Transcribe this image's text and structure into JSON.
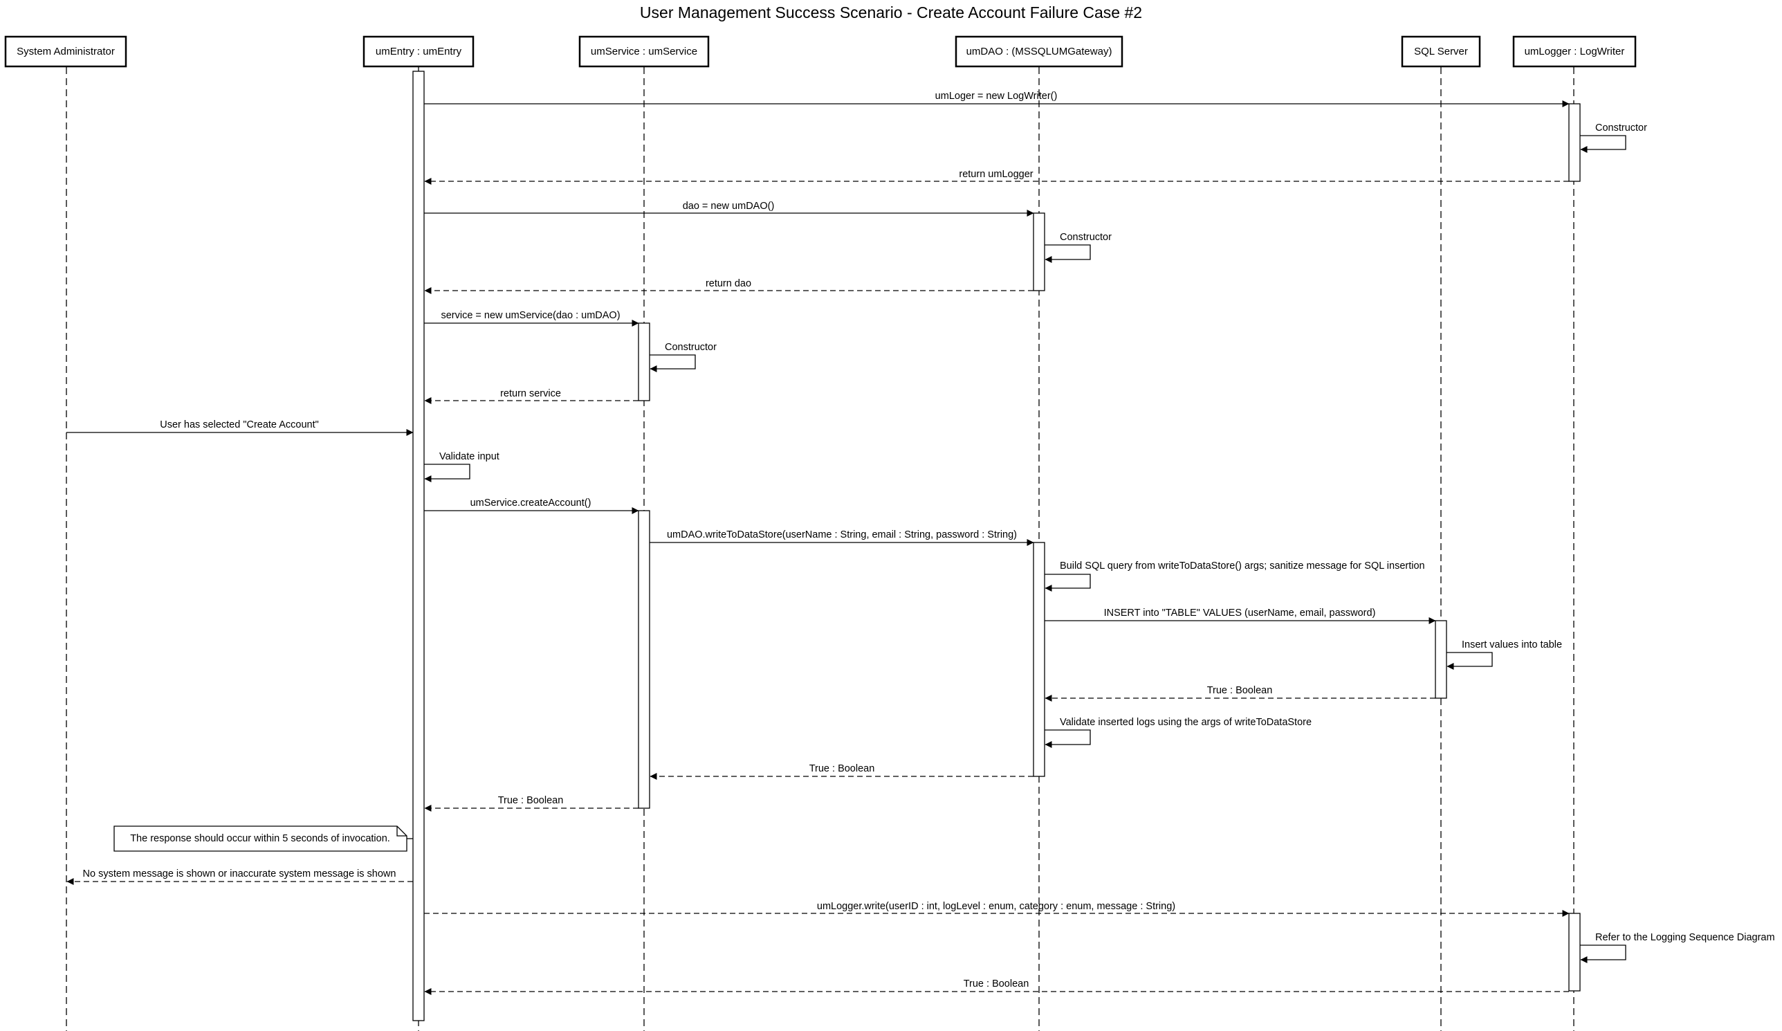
{
  "title": "User Management Success Scenario - Create Account Failure Case #2",
  "participants": [
    {
      "id": "admin",
      "label": "System Administrator"
    },
    {
      "id": "entry",
      "label": "umEntry : umEntry"
    },
    {
      "id": "service",
      "label": "umService : umService"
    },
    {
      "id": "dao",
      "label": "umDAO : (MSSQLUMGateway)"
    },
    {
      "id": "sql",
      "label": "SQL Server"
    },
    {
      "id": "logger",
      "label": "umLogger : LogWriter"
    }
  ],
  "messages": [
    {
      "from": "entry",
      "to": "logger",
      "kind": "sync",
      "label": "umLoger = new LogWriter()"
    },
    {
      "from": "logger",
      "to": "logger",
      "kind": "self",
      "label": "Constructor"
    },
    {
      "from": "logger",
      "to": "entry",
      "kind": "return",
      "label": "return umLogger"
    },
    {
      "from": "entry",
      "to": "dao",
      "kind": "sync",
      "label": "dao = new umDAO()"
    },
    {
      "from": "dao",
      "to": "dao",
      "kind": "self",
      "label": "Constructor"
    },
    {
      "from": "dao",
      "to": "entry",
      "kind": "return",
      "label": "return dao"
    },
    {
      "from": "entry",
      "to": "service",
      "kind": "sync",
      "label": "service = new umService(dao : umDAO)"
    },
    {
      "from": "service",
      "to": "service",
      "kind": "self",
      "label": "Constructor"
    },
    {
      "from": "service",
      "to": "entry",
      "kind": "return",
      "label": "return service"
    },
    {
      "from": "admin",
      "to": "entry",
      "kind": "sync",
      "label": "User has selected \"Create Account\""
    },
    {
      "from": "entry",
      "to": "entry",
      "kind": "self",
      "label": "Validate input"
    },
    {
      "from": "entry",
      "to": "service",
      "kind": "sync",
      "label": "umService.createAccount()"
    },
    {
      "from": "service",
      "to": "dao",
      "kind": "sync",
      "label": "umDAO.writeToDataStore(userName : String, email : String, password : String)"
    },
    {
      "from": "dao",
      "to": "dao",
      "kind": "self",
      "label": "Build SQL query from writeToDataStore() args; sanitize message for SQL insertion"
    },
    {
      "from": "dao",
      "to": "sql",
      "kind": "sync",
      "label": "INSERT into \"TABLE\" VALUES (userName, email, password)"
    },
    {
      "from": "sql",
      "to": "sql",
      "kind": "self",
      "label": "Insert values into table"
    },
    {
      "from": "sql",
      "to": "dao",
      "kind": "return",
      "label": "True : Boolean"
    },
    {
      "from": "dao",
      "to": "dao",
      "kind": "self",
      "label": "Validate inserted logs using the args of writeToDataStore"
    },
    {
      "from": "dao",
      "to": "service",
      "kind": "return",
      "label": "True : Boolean"
    },
    {
      "from": "service",
      "to": "entry",
      "kind": "return",
      "label": "True : Boolean"
    },
    {
      "from": "entry",
      "to": "admin",
      "kind": "return",
      "label": "No system message is shown or inaccurate system message is shown"
    },
    {
      "from": "entry",
      "to": "logger",
      "kind": "async",
      "label": "umLogger.write(userID : int, logLevel : enum, category : enum, message : String)"
    },
    {
      "from": "logger",
      "to": "logger",
      "kind": "self",
      "label": "Refer to the Logging Sequence Diagram"
    },
    {
      "from": "logger",
      "to": "entry",
      "kind": "return",
      "label": "True : Boolean"
    }
  ],
  "note": {
    "label": "The response should occur within 5 seconds of invocation.",
    "attached_to": "entry"
  }
}
